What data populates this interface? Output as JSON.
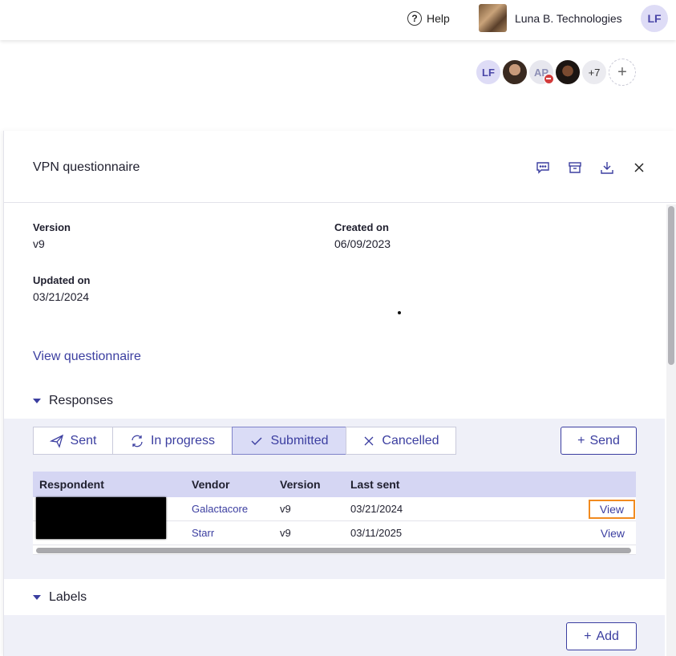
{
  "header": {
    "help_label": "Help",
    "org_name": "Luna B. Technologies",
    "user_initials": "LF"
  },
  "collaborators": {
    "items": [
      {
        "initials": "LF"
      },
      {
        "initials": ""
      },
      {
        "initials": "AP"
      },
      {
        "initials": ""
      }
    ],
    "more_count": "+7",
    "add_symbol": "+"
  },
  "panel": {
    "title": "VPN questionnaire",
    "icons": [
      "comment-icon",
      "archive-icon",
      "download-icon",
      "close-icon"
    ]
  },
  "meta": {
    "version_label": "Version",
    "version_value": "v9",
    "created_label": "Created on",
    "created_value": "06/09/2023",
    "updated_label": "Updated on",
    "updated_value": "03/21/2024"
  },
  "view_questionnaire": "View questionnaire",
  "responses": {
    "heading": "Responses",
    "filters": [
      {
        "label": "Sent",
        "icon": "paper-plane-icon"
      },
      {
        "label": "In progress",
        "icon": "refresh-icon"
      },
      {
        "label": "Submitted",
        "icon": "check-icon",
        "active": true
      },
      {
        "label": "Cancelled",
        "icon": "x-icon"
      }
    ],
    "send_label": "Send",
    "columns": [
      "Respondent",
      "Vendor",
      "Version",
      "Last sent"
    ],
    "rows": [
      {
        "respondent": "",
        "vendor": "Galactacore",
        "version": "v9",
        "last_sent": "03/21/2024",
        "action": "View"
      },
      {
        "respondent": "",
        "vendor": "Starr",
        "version": "v9",
        "last_sent": "03/11/2025",
        "action": "View"
      }
    ]
  },
  "labels": {
    "heading": "Labels",
    "add_label": "Add"
  },
  "colors": {
    "accent": "#3b3ea0",
    "highlight": "#f18a1f",
    "table_header": "#d5d6f3",
    "section_bg": "#eff0f8"
  }
}
